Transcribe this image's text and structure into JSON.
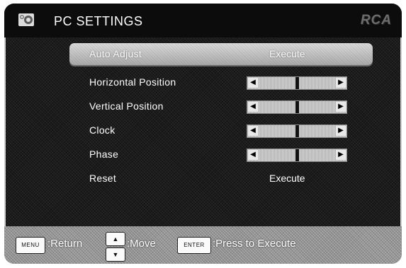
{
  "header": {
    "title": "PC SETTINGS",
    "brand": "RCA",
    "icon": "settings-icon"
  },
  "menu": {
    "items": [
      {
        "label": "Auto Adjust",
        "value": "Execute",
        "selected": true
      },
      {
        "label": "Horizontal Position",
        "slider_level": 0.5
      },
      {
        "label": "Vertical Position",
        "slider_level": 0.5
      },
      {
        "label": "Clock",
        "slider_level": 0.5
      },
      {
        "label": "Phase",
        "slider_level": 0.5
      },
      {
        "label": "Reset",
        "value": "Execute"
      }
    ]
  },
  "footer": {
    "menu_key": "MENU",
    "menu_action": ":Return",
    "move_action": ":Move",
    "enter_key": "ENTER",
    "enter_action": ":Press to Execute"
  }
}
